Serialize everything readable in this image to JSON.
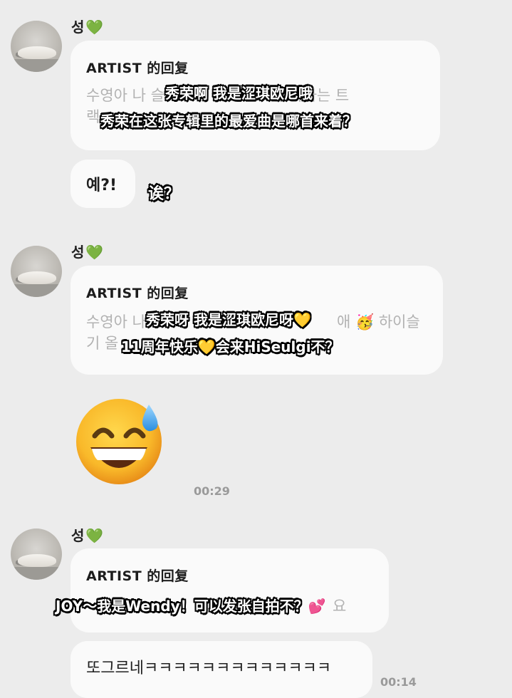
{
  "messages": [
    {
      "sender": "성",
      "card_header": "ARTIST 的回复",
      "card_text_line1": "수영아 나 슬",
      "card_text_line1b": "좋아하는 트",
      "card_text_line2": "랙",
      "overlay_line1": "秀荣啊 我是涩琪欧尼哦",
      "overlay_line2": "秀荣在这张专辑里的最爱曲是哪首来着？",
      "reply": "예?!",
      "reply_overlay": "诶？"
    },
    {
      "sender": "성",
      "card_header": "ARTIST 的回复",
      "card_text_line1": "수영아 나",
      "card_text_line1b": "애",
      "card_text_line1c": "하이슬",
      "card_text_line2": "기 올",
      "overlay_line1": "秀荣呀 我是涩琪欧尼呀💛",
      "overlay_line2": "11周年快乐💛会来HiSeulgi不？",
      "time": "00:29"
    },
    {
      "sender": "성",
      "card_header": "ARTIST 的回复",
      "card_text_line1": "요",
      "overlay_line1": "JOY～我是Wendy！可以发张自拍不？",
      "reply": "또그르네ㅋㅋㅋㅋㅋㅋㅋㅋㅋㅋㅋㅋㅋ",
      "time": "00:14"
    }
  ],
  "icons": {
    "green_heart": "💚",
    "yellow_heart": "💛",
    "party_face": "🥳",
    "sweat_smile": "😅",
    "two_hearts": "💕"
  },
  "colors": {
    "background": "#ececec",
    "card": "#fafafa",
    "heart": "#27c13b"
  }
}
